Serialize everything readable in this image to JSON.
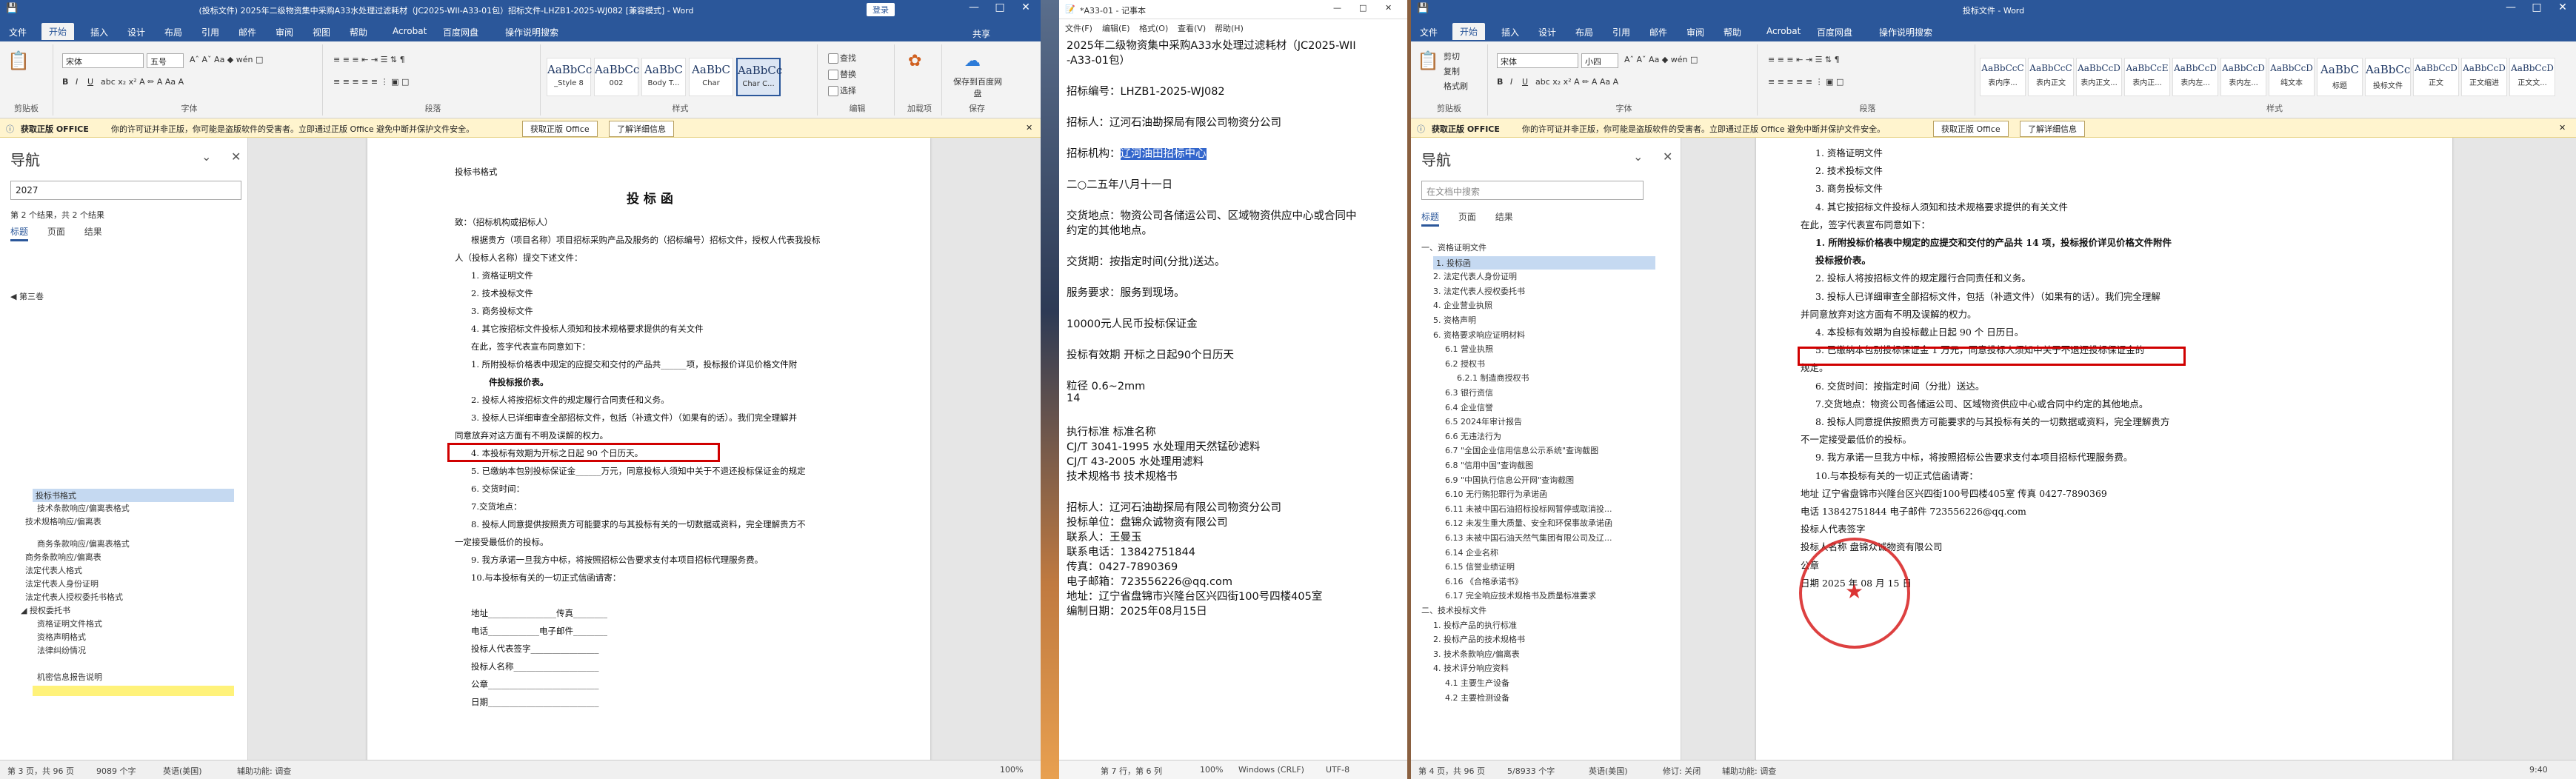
{
  "win1": {
    "save_icon": "save-icon",
    "title": "(投标文件) 2025年二级物资集中采购A33水处理过滤耗材（JC2025-WII-A33-01包）招标文件-LHZB1-2025-WJ082 [兼容模式] - Word",
    "login": "登录",
    "tabs": [
      "文件",
      "开始",
      "插入",
      "设计",
      "布局",
      "引用",
      "邮件",
      "审阅",
      "视图",
      "帮助",
      "Acrobat",
      "百度网盘",
      "操作说明搜索"
    ],
    "share": "共享",
    "font": "宋体",
    "font_size": "五号",
    "groups": [
      "剪贴板",
      "字体",
      "段落",
      "样式",
      "编辑",
      "加载项",
      "保存"
    ],
    "styles": [
      {
        "big": "AaBbCc",
        "nm": "_Style 8"
      },
      {
        "big": "AaBbCc",
        "nm": "002"
      },
      {
        "big": "AaBbC",
        "nm": "Body T..."
      },
      {
        "big": "AaBbC",
        "nm": "Char"
      },
      {
        "big": "AaBbCc",
        "nm": "Char C..."
      }
    ],
    "edit": [
      "查找",
      "替换",
      "选择"
    ],
    "addin": "加载项",
    "save_btn": "保存到百度网盘",
    "msg": {
      "label": "获取正版 OFFICE",
      "text": "你的许可证并非正版，你可能是盗版软件的受害者。立即通过正版 Office 避免中断并保护文件安全。",
      "btn1": "获取正版 Office",
      "btn2": "了解详细信息"
    },
    "nav_title": "导航",
    "search_value": "2027",
    "result_count": "第 2 个结果，共 2 个结果",
    "nav_tabs": [
      "标题",
      "页面",
      "结果"
    ],
    "nav_tree": "第三卷",
    "nav_items": [
      "投标书格式",
      "技术条款响应/偏离表格式",
      "技术规格响应/偏离表",
      "商务条款响应/偏离表格式",
      "商务条款响应/偏离表",
      "法定代表人格式",
      "法定代表人身份证明",
      "法定代表人授权委托书格式",
      "授权委托书",
      "资格证明文件格式",
      "资格声明格式",
      "法律纠纷情况",
      "机密信息报告说明"
    ],
    "page": {
      "head": "投标书格式",
      "title": "投 标 函",
      "lines": [
        "致：（招标机构或招标人）",
        "根据贵方（项目名称）项目招标采购产品及服务的（招标编号）招标文件，授权人代表我投标",
        "人（投标人名称）提交下述文件：",
        "1.   资格证明文件",
        "2.   技术投标文件",
        "3.   商务投标文件",
        "4.   其它按招标文件投标人须知和技术规格要求提供的有关文件",
        "在此，签字代表宣布同意如下：",
        "1.   所附投标价格表中规定的应提交和交付的产品共______项，投标报价详见价格文件附",
        "件投标报价表。",
        "2.   投标人将按招标文件的规定履行合同责任和义务。",
        "3.   投标人已详细审查全部招标文件，包括（补遗文件）（如果有的话）。我们完全理解并",
        "同意放弃对这方面有不明及误解的权力。",
        "4.   本投标有效期为开标之日起 90 个日历天。",
        "5.   已缴纳本包别投标保证金______万元，同意投标人须知中关于不退还投标保证金的规定",
        "6.   交货时间：",
        "7.交货地点：",
        "8.   投标人同意提供按照贵方可能要求的与其投标有关的一切数据或资料，完全理解贵方不",
        "一定接受最低价的投标。",
        "9.   我方承诺一旦我方中标，将按照招标公告要求支付本项目招标代理服务费。",
        "10.与本投标有关的一切正式信函请寄：",
        "地址________________传真________",
        "电话____________电子邮件________",
        "投标人代表签字________________",
        "投标人名称____________________",
        "公章__________________________",
        "日期__________________________"
      ]
    },
    "status": [
      "第 3 页，共 96 页",
      "9089 个字",
      "英语(美国)",
      "辅助功能: 调查",
      "100%"
    ]
  },
  "win2": {
    "title": "*A33-01 - 记事本",
    "menu": [
      "文件(F)",
      "编辑(E)",
      "格式(O)",
      "查看(V)",
      "帮助(H)"
    ],
    "lines": [
      "2025年二级物资集中采购A33水处理过滤耗材（JC2025-WII",
      "-A33-01包）",
      "",
      "招标编号：LHZB1-2025-WJ082",
      "",
      "招标人：辽河石油勘探局有限公司物资分公司",
      "",
      "招标机构：辽河油田招标中心",
      "",
      "二○二五年八月十一日",
      "",
      "交货地点：物资公司各储运公司、区域物资供应中心或合同中",
      "约定的其他地点。",
      "",
      "交货期：按指定时间(分批)送达。",
      "",
      "服务要求：服务到现场。",
      "",
      "10000元人民币投标保证金",
      "",
      "投标有效期           开标之日起90个日历天",
      "",
      "粒径 0.6~2mm",
      "14",
      "",
      "执行标准  标准名称",
      "CJ/T 3041-1995       水处理用天然锰砂滤料",
      "CJ/T 43-2005        水处理用滤料",
      "技术规格书           技术规格书",
      "",
      "招标人：辽河石油勘探局有限公司物资分公司",
      "投标单位：盘锦众诚物资有限公司",
      "联系人：王曼玉",
      "联系电话：13842751844",
      "传真：0427-7890369",
      "电子邮箱：723556226@qq.com",
      "地址：辽宁省盘锦市兴隆台区兴四街100号四楼405室",
      "编制日期：2025年08月15日"
    ],
    "highlight": "辽河油田招标中心",
    "status": [
      "第 7 行，第 6 列",
      "100%",
      "Windows (CRLF)",
      "UTF-8"
    ]
  },
  "win3": {
    "title": "投标文件 - Word",
    "tabs": [
      "文件",
      "开始",
      "插入",
      "设计",
      "布局",
      "引用",
      "邮件",
      "审阅",
      "帮助",
      "Acrobat",
      "百度网盘",
      "操作说明搜索"
    ],
    "font": "宋体",
    "font_size": "小四",
    "clip": [
      "剪切",
      "复制",
      "格式刷"
    ],
    "styles": [
      {
        "big": "AaBbCcC",
        "nm": "表内序..."
      },
      {
        "big": "AaBbCcC",
        "nm": "表内正文"
      },
      {
        "big": "AaBbCcD",
        "nm": "表内正文..."
      },
      {
        "big": "AaBbCcE",
        "nm": "表内正..."
      },
      {
        "big": "AaBbCcD",
        "nm": "表内左..."
      },
      {
        "big": "AaBbCcD",
        "nm": "表内左..."
      },
      {
        "big": "AaBbCcD",
        "nm": "纯文本"
      },
      {
        "big": "AaBbC",
        "nm": "标题"
      },
      {
        "big": "AaBbCc",
        "nm": "投标文件"
      },
      {
        "big": "AaBbCcD",
        "nm": "正文"
      },
      {
        "big": "AaBbCcD",
        "nm": "正文缩进"
      },
      {
        "big": "AaBbCcD",
        "nm": "正文文..."
      }
    ],
    "groups": [
      "剪贴板",
      "字体",
      "段落",
      "样式"
    ],
    "msg": {
      "label": "获取正版 OFFICE",
      "text": "你的许可证并非正版，你可能是盗版软件的受害者。立即通过正版 Office 避免中断并保护文件安全。",
      "btn1": "获取正版 Office",
      "btn2": "了解详细信息"
    },
    "nav_title": "导航",
    "search_placeholder": "在文档中搜索",
    "nav_tabs": [
      "标题",
      "页面",
      "结果"
    ],
    "tree": [
      {
        "t": "一、资格证明文件",
        "lv": 0
      },
      {
        "t": "1. 投标函",
        "lv": 1,
        "hl": true
      },
      {
        "t": "2. 法定代表人身份证明",
        "lv": 1
      },
      {
        "t": "3. 法定代表人授权委托书",
        "lv": 1
      },
      {
        "t": "4. 企业营业执照",
        "lv": 1
      },
      {
        "t": "5. 资格声明",
        "lv": 1
      },
      {
        "t": "6. 资格要求响应证明材料",
        "lv": 1
      },
      {
        "t": "6.1 营业执照",
        "lv": 2
      },
      {
        "t": "6.2 授权书",
        "lv": 2
      },
      {
        "t": "6.2.1 制造商授权书",
        "lv": 3
      },
      {
        "t": "6.3 银行资信",
        "lv": 2
      },
      {
        "t": "6.4 企业信誉",
        "lv": 2
      },
      {
        "t": "6.5 2024年审计报告",
        "lv": 2
      },
      {
        "t": "6.6 无违法行为",
        "lv": 2
      },
      {
        "t": "6.7 \"全国企业信用信息公示系统\"查询截图",
        "lv": 2
      },
      {
        "t": "6.8 \"信用中国\"查询截图",
        "lv": 2
      },
      {
        "t": "6.9 \"中国执行信息公开网\"查询截图",
        "lv": 2
      },
      {
        "t": "6.10 无行贿犯罪行为承诺函",
        "lv": 2
      },
      {
        "t": "6.11 未被中国石油招标投标网暂停或取消投...",
        "lv": 2
      },
      {
        "t": "6.12 未发生重大质量、安全和环保事故承诺函",
        "lv": 2
      },
      {
        "t": "6.13 未被中国石油天然气集团有限公司及辽...",
        "lv": 2
      },
      {
        "t": "6.14 企业名称",
        "lv": 2
      },
      {
        "t": "6.15 信誉业绩证明",
        "lv": 2
      },
      {
        "t": "6.16 《合格承诺书》",
        "lv": 2
      },
      {
        "t": "6.17 完全响应技术规格书及质量标准要求",
        "lv": 2
      },
      {
        "t": "二、技术投标文件",
        "lv": 0
      },
      {
        "t": "1. 投标产品的执行标准",
        "lv": 1
      },
      {
        "t": "2. 投标产品的技术规格书",
        "lv": 1
      },
      {
        "t": "3. 技术条款响应/偏离表",
        "lv": 1
      },
      {
        "t": "4. 技术评分响应资料",
        "lv": 1
      },
      {
        "t": "4.1 主要生产设备",
        "lv": 2
      },
      {
        "t": "4.2 主要检测设备",
        "lv": 2
      }
    ],
    "page": {
      "lines": [
        "1.   资格证明文件",
        "2.   技术投标文件",
        "3.   商务投标文件",
        "4.   其它按招标文件投标人须知和技术规格要求提供的有关文件",
        "在此，签字代表宣布同意如下：",
        "1.   所附投标价格表中规定的应提交和交付的产品共  14  项，投标报价详见价格文件附件",
        "投标报价表。",
        "2.   投标人将按招标文件的规定履行合同责任和义务。",
        "3.   投标人已详细审查全部招标文件，包括（补遗文件）（如果有的话）。我们完全理解",
        "并同意放弃对这方面有不明及误解的权力。",
        "4.   本投标有效期为自投标截止日起  90  个  日历日。",
        "5.   已缴纳本包别投标保证金    1    万元，同意投标人须知中关于不退还投标保证金的",
        "规定。",
        "6.   交货时间：按指定时间（分批）送达。",
        "7.交货地点：物资公司各储运公司、区域物资供应中心或合同中约定的其他地点。",
        "8.   投标人同意提供按照贵方可能要求的与其投标有关的一切数据或资料，完全理解贵方",
        "不一定接受最低价的投标。",
        "9.   我方承诺一旦我方中标，将按照招标公告要求支付本项目招标代理服务费。",
        "10.与本投标有关的一切正式信函请寄：",
        "地址  辽宁省盘锦市兴隆台区兴四街100号四楼405室  传真  0427-7890369",
        "电话  13842751844   电子邮件  723556226@qq.com",
        "投标人代表签字",
        "投标人名称  盘锦众诚物资有限公司",
        "公章",
        "日期    2025 年 08 月 15 日"
      ]
    },
    "status": [
      "第 4 页，共 96 页",
      "5/8933 个字",
      "英语(美国)",
      "修订: 关闭",
      "辅助功能: 调查"
    ]
  },
  "taskbar_time": "9:40"
}
